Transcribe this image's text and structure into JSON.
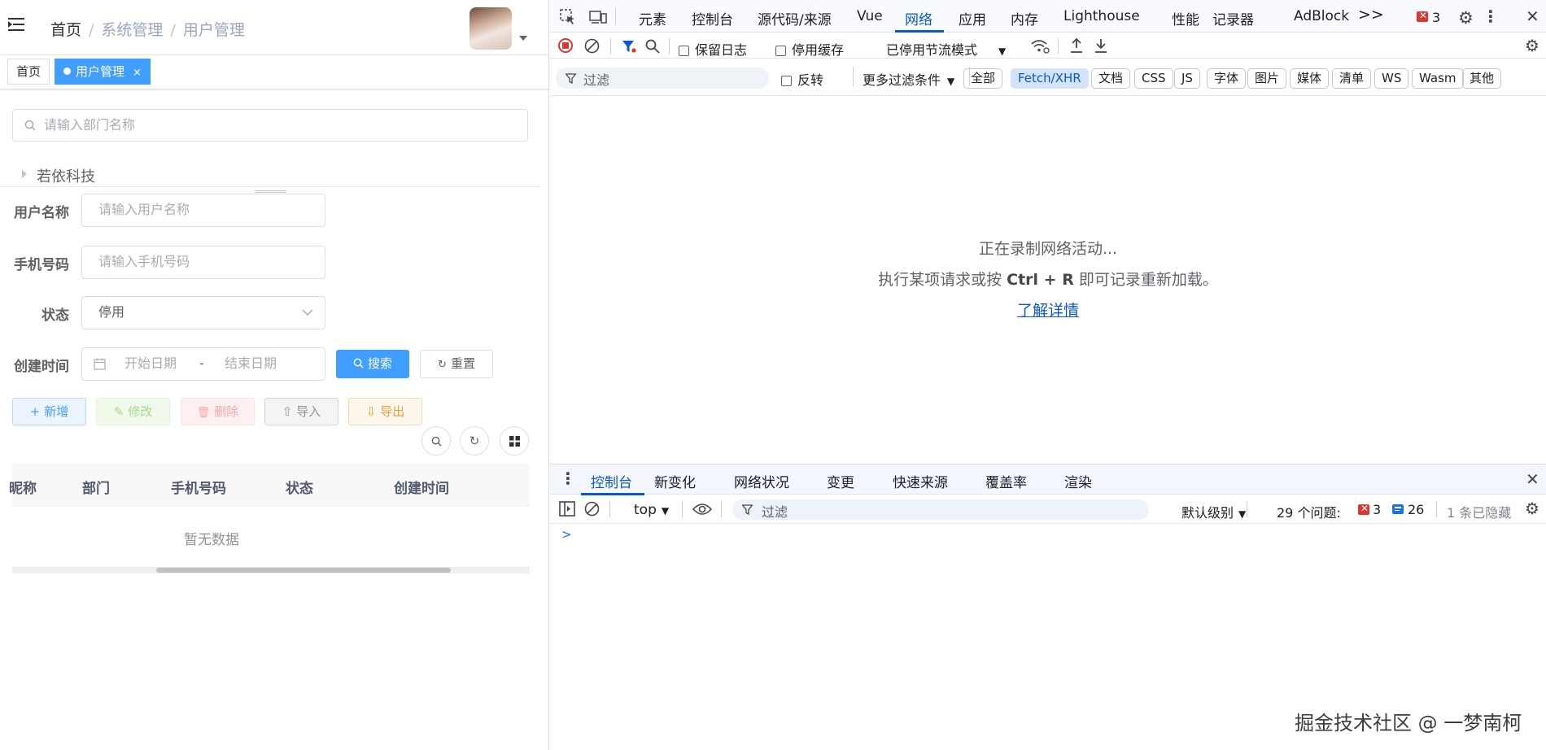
{
  "breadcrumb": [
    "首页",
    "系统管理",
    "用户管理"
  ],
  "tags": {
    "home": "首页",
    "active": "用户管理",
    "close": "×"
  },
  "dept": {
    "placeholder": "请输入部门名称",
    "tree_root": "若依科技"
  },
  "form": {
    "username_label": "用户名称",
    "username_placeholder": "请输入用户名称",
    "phone_label": "手机号码",
    "phone_placeholder": "请输入手机号码",
    "status_label": "状态",
    "status_value": "停用",
    "created_label": "创建时间",
    "start_placeholder": "开始日期",
    "range_sep": "-",
    "end_placeholder": "结束日期",
    "search": "搜索",
    "reset": "重置"
  },
  "actions": {
    "add": "新增",
    "edit": "修改",
    "delete": "删除",
    "import": "导入",
    "export": "导出"
  },
  "table": {
    "headers": [
      "昵称",
      "部门",
      "手机号码",
      "状态",
      "创建时间"
    ],
    "empty": "暂无数据"
  },
  "devtools": {
    "tabs": [
      "元素",
      "控制台",
      "源代码/来源",
      "Vue",
      "网络",
      "应用",
      "内存",
      "Lighthouse",
      "性能",
      "记录器",
      "AdBlock"
    ],
    "more": ">>",
    "error_count": "3",
    "toolbar": {
      "preserve_log": "保留日志",
      "disable_cache": "停用缓存",
      "throttle": "已停用节流模式"
    },
    "filter": {
      "placeholder": "过滤",
      "invert": "反转",
      "more_filters": "更多过滤条件"
    },
    "chips": [
      "全部",
      "Fetch/XHR",
      "文档",
      "CSS",
      "JS",
      "字体",
      "图片",
      "媒体",
      "清单",
      "WS",
      "Wasm",
      "其他"
    ],
    "empty": {
      "line1": "正在录制网络活动...",
      "line2_pre": "执行某项请求或按",
      "line2_key": "Ctrl + R",
      "line2_post": "即可记录重新加载。",
      "link": "了解详情"
    },
    "drawer_tabs": [
      "控制台",
      "新变化",
      "网络状况",
      "变更",
      "快速来源",
      "覆盖率",
      "渲染"
    ],
    "console": {
      "context": "top",
      "filter_placeholder": "过滤",
      "level": "默认级别",
      "issues": "29 个问题:",
      "err": "3",
      "info": "26",
      "hidden": "1 条已隐藏",
      "prompt": ">"
    }
  },
  "watermark": "掘金技术社区 @ 一梦南柯"
}
